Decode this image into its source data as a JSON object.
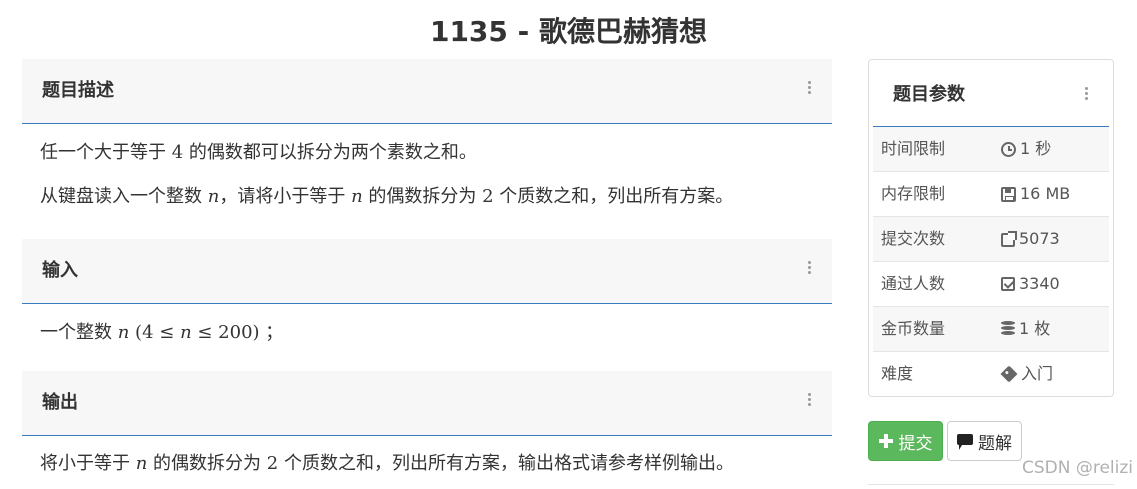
{
  "page": {
    "title": "1135 - 歌德巴赫猜想"
  },
  "description": {
    "heading": "题目描述",
    "line1_pre": "任一个大于等于 ",
    "line1_num": "4",
    "line1_post": " 的偶数都可以拆分为两个素数之和。",
    "line2_a": "从键盘读入一个整数 ",
    "line2_var1": "n",
    "line2_b": "，请将小于等于 ",
    "line2_var2": "n",
    "line2_c": " 的偶数拆分为 ",
    "line2_num": "2",
    "line2_d": " 个质数之和，列出所有方案。"
  },
  "input": {
    "heading": "输入",
    "text_pre": "一个整数 ",
    "var": "n",
    "range_open": " (4 ≤ ",
    "range_var": "n",
    "range_close": " ≤ 200)",
    "text_post": " ；"
  },
  "output": {
    "heading": "输出",
    "text_pre": "将小于等于 ",
    "var": "n",
    "text_mid": " 的偶数拆分为 ",
    "num": "2",
    "text_post": " 个质数之和，列出所有方案，输出格式请参考样例输出。"
  },
  "params": {
    "heading": "题目参数",
    "rows": [
      {
        "label": "时间限制",
        "value": "1 秒",
        "icon": "clock-icon"
      },
      {
        "label": "内存限制",
        "value": "16 MB",
        "icon": "floppy-disk-icon"
      },
      {
        "label": "提交次数",
        "value": "5073",
        "icon": "share-icon"
      },
      {
        "label": "通过人数",
        "value": "3340",
        "icon": "check-square-icon"
      },
      {
        "label": "金币数量",
        "value": "1 枚",
        "icon": "database-icon"
      },
      {
        "label": "难度",
        "value": "入门",
        "icon": "tag-icon"
      }
    ]
  },
  "actions": {
    "submit_label": "提交",
    "solution_label": "题解",
    "submit_color": "#5cb85c"
  },
  "watermark": "CSDN @relizi"
}
